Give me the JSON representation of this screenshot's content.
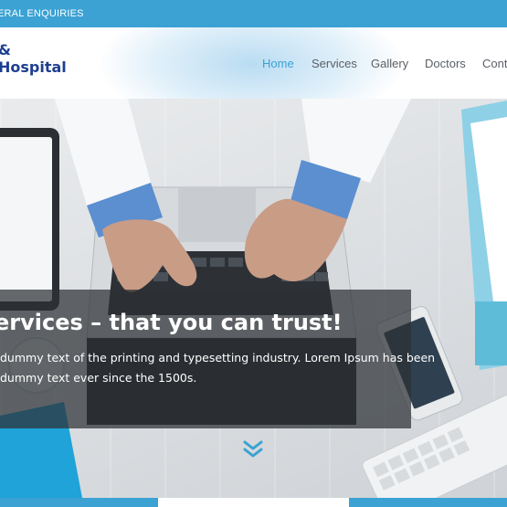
{
  "topbar": {
    "text": "ERAL ENQUIRIES"
  },
  "logo": {
    "amp": "&",
    "name": "Hospital"
  },
  "nav": {
    "items": [
      {
        "label": "Home",
        "active": true
      },
      {
        "label": "Services",
        "active": false
      },
      {
        "label": "Gallery",
        "active": false
      },
      {
        "label": "Doctors",
        "active": false
      },
      {
        "label": "Conta",
        "active": false
      }
    ]
  },
  "hero": {
    "title": "ervices – that you can trust!",
    "body_line_1": "dummy text of the printing and typesetting industry. Lorem Ipsum has been",
    "body_line_2": "dummy text ever since the 1500s.",
    "scroll_icon": "chevron-double-down-icon"
  },
  "colors": {
    "accent": "#3ba2d3",
    "logo": "#1d3f8f",
    "nav_text": "#5a5f66",
    "caption_bg": "rgba(45,48,52,0.72)"
  }
}
